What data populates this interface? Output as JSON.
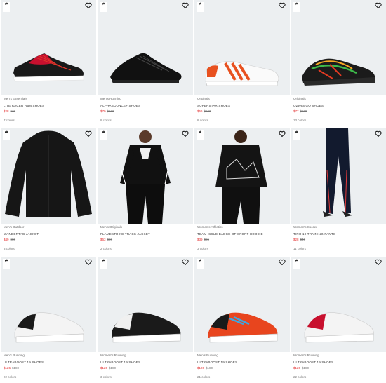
{
  "products": [
    {
      "category": "Men's Essentials",
      "name": "LITE RACER RBN SHOES",
      "sale": "$28",
      "orig": "$70",
      "colors": "7 colors"
    },
    {
      "category": "Men's Running",
      "name": "ALPHABOUNCE+ SHOES",
      "sale": "$70",
      "orig": "$100",
      "colors": "8 colors"
    },
    {
      "category": "Originals",
      "name": "SUPERSTAR SHOES",
      "sale": "$56",
      "orig": "$100",
      "colors": "8 colors"
    },
    {
      "category": "Originals",
      "name": "OZWEEGO SHOES",
      "sale": "$77",
      "orig": "$110",
      "colors": "13 colors"
    },
    {
      "category": "Men's Outdoor",
      "name": "WANDERTAG JACKET",
      "sale": "$49",
      "orig": "$80",
      "colors": "3 colors"
    },
    {
      "category": "Men's Originals",
      "name": "FLAMESTRIKE TRACK JACKET",
      "sale": "$63",
      "orig": "$90",
      "colors": "2 colors"
    },
    {
      "category": "Women's Athletics",
      "name": "TEAM ISSUE BADGE OF SPORT HOODIE",
      "sale": "$39",
      "orig": "$65",
      "colors": "3 colors"
    },
    {
      "category": "Women's Soccer",
      "name": "TIRO 19 TRAINING PANTS",
      "sale": "$28",
      "orig": "$45",
      "colors": "11 colors"
    },
    {
      "category": "Men's Running",
      "name": "ULTRABOOST 19 SHOES",
      "sale": "$126",
      "orig": "$180",
      "colors": "22 colors"
    },
    {
      "category": "Women's Running",
      "name": "ULTRABOOST 19 SHOES",
      "sale": "$126",
      "orig": "$180",
      "colors": "3 colors"
    },
    {
      "category": "Men's Running",
      "name": "ULTRABOOST 19 SHOES",
      "sale": "$126",
      "orig": "$180",
      "colors": "21 colors"
    },
    {
      "category": "Women's Running",
      "name": "ULTRABOOST 19 SHOES",
      "sale": "$126",
      "orig": "$180",
      "colors": "22 colors"
    }
  ],
  "icons": {
    "heart": "heart-icon",
    "compare": "compare-icon"
  }
}
